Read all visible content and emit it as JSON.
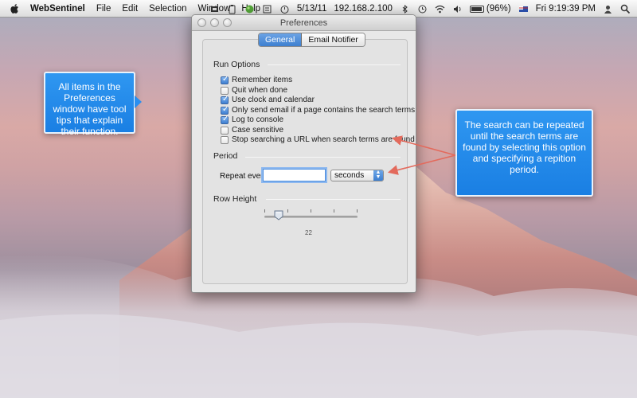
{
  "menubar": {
    "app_name": "WebSentinel",
    "menus": [
      "File",
      "Edit",
      "Selection",
      "Window",
      "Help"
    ],
    "date": "5/13/11",
    "ip": "192.168.2.100",
    "battery": "(96%)",
    "clock": "Fri 9:19:39 PM"
  },
  "window": {
    "title": "Preferences",
    "tabs": [
      {
        "label": "General",
        "selected": true
      },
      {
        "label": "Email Notifier",
        "selected": false
      }
    ],
    "run_options": {
      "title": "Run Options",
      "options": [
        {
          "label": "Remember items",
          "checked": true
        },
        {
          "label": "Quit when done",
          "checked": false
        },
        {
          "label": "Use clock and calendar",
          "checked": true
        },
        {
          "label": "Only send email if a page contains the search terms",
          "checked": true
        },
        {
          "label": "Log to console",
          "checked": true
        },
        {
          "label": "Case sensitive",
          "checked": false
        },
        {
          "label": "Stop searching a URL when search terms are found",
          "checked": false
        }
      ]
    },
    "period": {
      "title": "Period",
      "label": "Repeat every",
      "value": "",
      "unit": "seconds"
    },
    "row_height": {
      "title": "Row Height",
      "value": "22"
    }
  },
  "callouts": {
    "left": "All items in the Preferences window have tool tips that explain their function.",
    "right": "The search can be repeated until the search terms are found by selecting this option and specifying a repition period."
  },
  "colors": {
    "callout_blue": "#1f86e8",
    "arrow_red": "#e36a5c",
    "tab_selected": "#3d7fd0"
  }
}
